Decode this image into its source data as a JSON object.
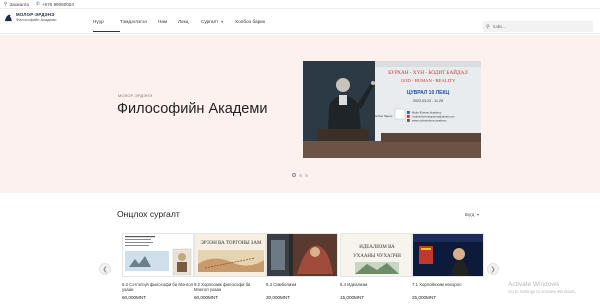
{
  "topbar": {
    "address": "Захиалга",
    "phone": "+976 99080004"
  },
  "logo": {
    "line1": "МОЛОР-ЭРДЭНЭ",
    "line2": "Философийн Академи"
  },
  "nav": [
    {
      "label": "Нүүр",
      "active": true
    },
    {
      "label": "Тэмдэглэгээ",
      "active": false
    },
    {
      "label": "Нөм",
      "active": false
    },
    {
      "label": "Лекц",
      "active": false
    },
    {
      "label": "Сургалт",
      "active": false,
      "dropdown": true
    },
    {
      "label": "Холбоо барих",
      "active": false
    }
  ],
  "search": {
    "placeholder": "Хайх..."
  },
  "hero": {
    "eyebrow": "МОЛОР-ЭРДЭНЭ",
    "title": "Философийн Академи",
    "slide": {
      "heading1": "БУРХАН - ХҮН - БОДИТ БАЙДАЛ",
      "heading2": "GOD - HUMAN - REALITY",
      "tag": "ЦУВРАЛ 10 ЛЕКЦ",
      "date": "2023.03.23 - 11.25",
      "contact_label": "Холбоо барих:",
      "contact_name": "Molor-Erdene Academy",
      "contact_email": "molorerdeneacademy@gmail.com",
      "contact_site": "www.molorerdene.academy"
    },
    "dots": 3,
    "active_dot": 0
  },
  "courses": {
    "title": "Онцлох сургалт",
    "sort_label": "Бүгд",
    "items": [
      {
        "name": "9.2 Сэтгэлгүй философи ба Монгол ухаан",
        "price": "60,000MNT"
      },
      {
        "name": "9.2 Хорлоомж философи ба Монгол ухаан",
        "price": "60,000MNT"
      },
      {
        "name": "8.3 Симболизм",
        "price": "30,000MNT"
      },
      {
        "name": "6.4 Идеализм",
        "price": "15,000MNT"
      },
      {
        "name": "7.1 Хорлойнхим нөхорол",
        "price": "25,000MNT"
      }
    ],
    "thumbs": {
      "t2": "ЭРЭЭН ВА ТОРГОНЫ ЗАМ",
      "t4a": "ИДЕАЛИЗМ ВА",
      "t4b": "УХААНЫ ЧУХАЛЧИ"
    }
  },
  "watermark": {
    "line1": "Activate Windows",
    "line2": "Go to Settings to activate Windows."
  },
  "colors": {
    "hero_bg": "#fdf1ef",
    "accent": "#1b2b4a"
  }
}
